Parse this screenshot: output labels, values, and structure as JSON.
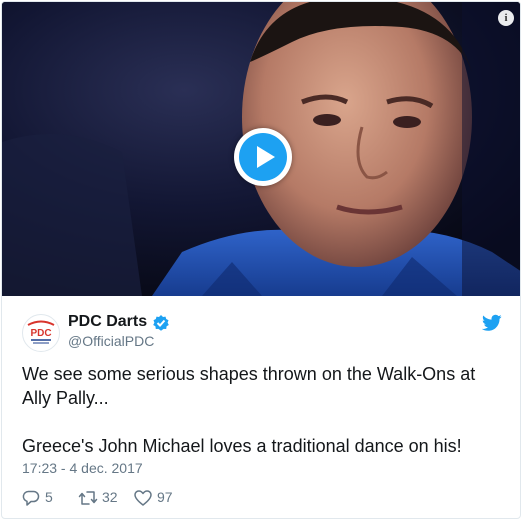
{
  "media": {
    "info_icon": "info-icon",
    "play_icon": "play-icon"
  },
  "author": {
    "avatar_text": "PDC",
    "name": "PDC Darts",
    "handle": "@OfficialPDC",
    "verified": true
  },
  "tweet": {
    "paragraphs": [
      "We see some serious shapes thrown on the Walk-Ons at Ally Pally...",
      "Greece's John Michael loves a traditional dance on his!"
    ],
    "timestamp": "17:23 - 4 dec. 2017"
  },
  "actions": {
    "replies": "5",
    "retweets": "32",
    "likes": "97"
  },
  "colors": {
    "accent": "#1da1f2",
    "text": "#14171a",
    "muted": "#657786",
    "border": "#e1e8ed"
  }
}
